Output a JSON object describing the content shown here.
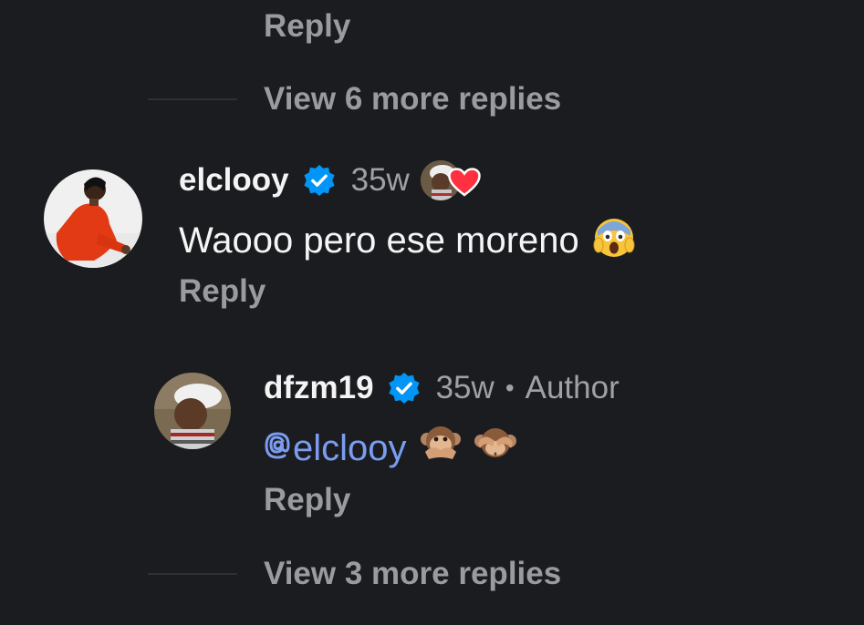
{
  "top": {
    "reply_label": "Reply",
    "more_replies_label": "View 6 more replies"
  },
  "comment1": {
    "username": "elclooy",
    "time": "35w",
    "text": "Waooo pero ese moreno",
    "reply_label": "Reply",
    "verified_icon": "verified-badge-icon",
    "liked_by_author_icon": "heart-icon"
  },
  "comment2": {
    "username": "dfzm19",
    "time": "35w",
    "separator": "•",
    "author_label": "Author",
    "mention": "elclooy",
    "reply_label": "Reply"
  },
  "bottom": {
    "more_replies_label": "View 3 more replies"
  },
  "colors": {
    "background": "#1b1c1f",
    "verified": "#0095f6",
    "mention": "#7b9cf0",
    "heart": "#ff3040",
    "muted_text": "#9a9b9f"
  }
}
